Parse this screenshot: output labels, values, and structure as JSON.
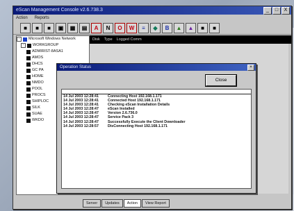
{
  "window": {
    "title": "eScan Management Console v2.6.738.3",
    "buttons": [
      "_",
      "□",
      "X"
    ]
  },
  "menu": [
    "Action",
    "Reports"
  ],
  "toolbar": {
    "buttons": [
      {
        "glyph": "■",
        "color": "plain"
      },
      {
        "glyph": "■",
        "color": "plain"
      },
      {
        "glyph": "■",
        "color": "plain"
      },
      {
        "glyph": "▣",
        "color": "plain"
      },
      {
        "glyph": "▦",
        "color": "plain"
      },
      {
        "glyph": "▤",
        "color": "plain"
      },
      {
        "glyph": "A",
        "color": "red"
      },
      {
        "glyph": "N",
        "color": "plain"
      },
      {
        "glyph": "O",
        "color": "red"
      },
      {
        "glyph": "W",
        "color": "red"
      },
      {
        "glyph": "≡",
        "color": "blue"
      },
      {
        "glyph": "◆",
        "color": "teal"
      },
      {
        "glyph": "B",
        "color": "blue"
      },
      {
        "glyph": "▲",
        "color": "green"
      },
      {
        "glyph": "▲",
        "color": "purple"
      },
      {
        "glyph": "■",
        "color": "plain"
      },
      {
        "glyph": "■",
        "color": "plain"
      }
    ]
  },
  "tree": {
    "root": "Microsoft Windows Network",
    "group": "WORKGROUP",
    "items": [
      "ADMIRIST-8ASA1",
      "AMOS",
      "DHCS",
      "GC PA",
      "HOME",
      "NMDO",
      "POOL",
      "PROCS",
      "SHIPLOC",
      "SILK",
      "SUAE",
      "WKDO"
    ]
  },
  "pane": {
    "headers": [
      "Disk",
      "Type",
      "Logged Comm"
    ]
  },
  "tabs": [
    "Server",
    "Updates",
    "Action",
    "View Report"
  ],
  "dialog": {
    "title": "Operation Status",
    "close_label": "Close",
    "log": [
      {
        "time": "14 Jul 2003 12:28:41",
        "msg": "Connecting Host 192.168.1.171"
      },
      {
        "time": "14 Jul 2003 12:28:41",
        "msg": "Connected Host 192.168.1.171"
      },
      {
        "time": "14 Jul 2003 12:28:41",
        "msg": "Checking eScan Installation Details"
      },
      {
        "time": "14 Jul 2003 12:28:47",
        "msg": "eScan Installed"
      },
      {
        "time": "14 Jul 2003 12:28:47",
        "msg": "Version 2.6.736.0"
      },
      {
        "time": "14 Jul 2003 12:28:47",
        "msg": "Service Pack 3"
      },
      {
        "time": "14 Jul 2003 12:28:47",
        "msg": "Successfully Execute the Client Downloader"
      },
      {
        "time": "14 Jul 2003 12:28:57",
        "msg": "DisConnecting Host 192.168.1.171"
      }
    ]
  }
}
